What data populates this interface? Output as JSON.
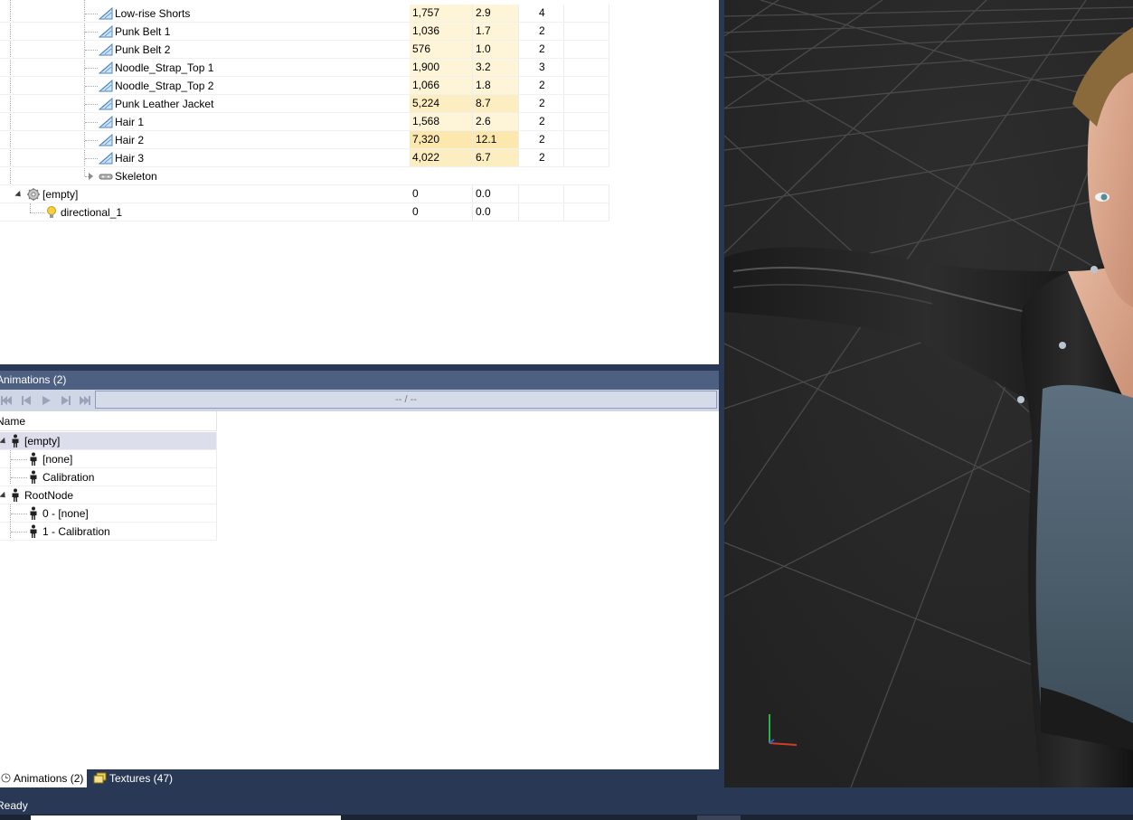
{
  "scene_tree": {
    "rows": [
      {
        "name": "Low-rise Shorts",
        "c1": "1,757",
        "c2": "2.9",
        "c3": "4",
        "icon": "mesh-icon"
      },
      {
        "name": "Punk Belt 1",
        "c1": "1,036",
        "c2": "1.7",
        "c3": "2",
        "icon": "mesh-icon"
      },
      {
        "name": "Punk Belt 2",
        "c1": "576",
        "c2": "1.0",
        "c3": "2",
        "icon": "mesh-icon"
      },
      {
        "name": "Noodle_Strap_Top 1",
        "c1": "1,900",
        "c2": "3.2",
        "c3": "3",
        "icon": "mesh-icon"
      },
      {
        "name": "Noodle_Strap_Top 2",
        "c1": "1,066",
        "c2": "1.8",
        "c3": "2",
        "icon": "mesh-icon"
      },
      {
        "name": "Punk Leather Jacket",
        "c1": "5,224",
        "c2": "8.7",
        "c3": "2",
        "icon": "mesh-icon"
      },
      {
        "name": "Hair 1",
        "c1": "1,568",
        "c2": "2.6",
        "c3": "2",
        "icon": "mesh-icon"
      },
      {
        "name": "Hair 2",
        "c1": "7,320",
        "c2": "12.1",
        "c3": "2",
        "icon": "mesh-icon"
      },
      {
        "name": "Hair 3",
        "c1": "4,022",
        "c2": "6.7",
        "c3": "2",
        "icon": "mesh-icon"
      },
      {
        "name": "Skeleton",
        "c1": "",
        "c2": "",
        "c3": "",
        "icon": "skeleton-icon"
      },
      {
        "name": "[empty]",
        "c1": "0",
        "c2": "0.0",
        "c3": "",
        "icon": "gear-icon"
      },
      {
        "name": "directional_1",
        "c1": "0",
        "c2": "0.0",
        "c3": "",
        "icon": "light-bulb-icon"
      }
    ]
  },
  "animations": {
    "title": "Animations (2)",
    "progress": "-- / --",
    "column_name": "Name",
    "rows": [
      {
        "label": "[empty]"
      },
      {
        "label": "[none]"
      },
      {
        "label": "Calibration"
      },
      {
        "label": "RootNode"
      },
      {
        "label": "0 - [none]"
      },
      {
        "label": "1 - Calibration"
      }
    ]
  },
  "tabs": [
    {
      "label": "Animations (2)",
      "icon": "clock-icon"
    },
    {
      "label": "Textures (47)",
      "icon": "textures-icon"
    }
  ],
  "status": {
    "text": "Ready"
  },
  "colors": {
    "accent": "#293955",
    "panel_title": "#4d6082",
    "highlight": "#fce7ad",
    "viewport_bg": "#262626"
  }
}
